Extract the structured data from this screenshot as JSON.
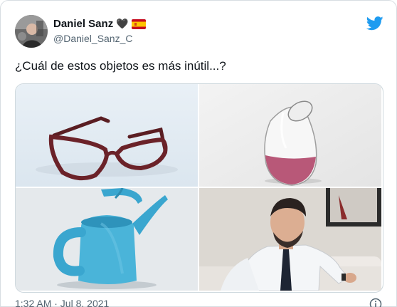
{
  "author": {
    "name": "Daniel Sanz",
    "emoji": "🖤",
    "flag": "spain-flag",
    "handle": "@Daniel_Sanz_C"
  },
  "tweet": {
    "text": "¿Cuál de estos objetos es más inútil...?"
  },
  "media": {
    "images": [
      {
        "icon": "eyeglasses-image"
      },
      {
        "icon": "wine-glass-image"
      },
      {
        "icon": "watering-can-image"
      },
      {
        "icon": "man-on-sofa-image"
      }
    ]
  },
  "footer": {
    "timestamp": "1:32 AM · Jul 8, 2021"
  },
  "colors": {
    "twitter_blue": "#1d9bf0",
    "text": "#0f1419",
    "muted": "#536471"
  }
}
